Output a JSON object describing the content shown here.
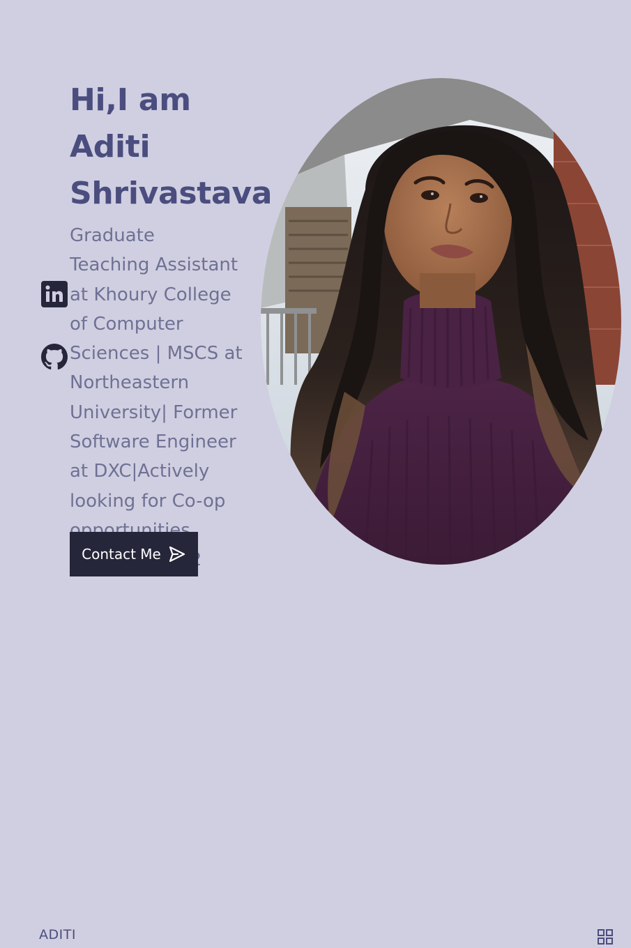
{
  "social": {
    "linkedin_icon": "linkedin-icon",
    "github_icon": "github-icon"
  },
  "hero": {
    "title": "Hi,I am Aditi\nShrivastava",
    "subtitle": "Graduate\nTeaching Assistant\nat Khoury College\nof Computer\nSciences | MSCS at\nNortheastern\nUniversity| Former\nSoftware Engineer\nat DXC|Actively\nlooking for Co-op\nopportunities\nstarting Jan'22",
    "contact_label": "Contact Me",
    "contact_icon": "send-icon"
  },
  "photo": {
    "alt": "Portrait of Aditi Shrivastava"
  },
  "footer": {
    "logo": "ADITI",
    "menu_icon": "grid-menu-icon"
  },
  "colors": {
    "background": "#d0cfe1",
    "title": "#4a4d7e",
    "subtitle": "#6e7194",
    "button": "#26263a",
    "icon": "#26263a"
  }
}
